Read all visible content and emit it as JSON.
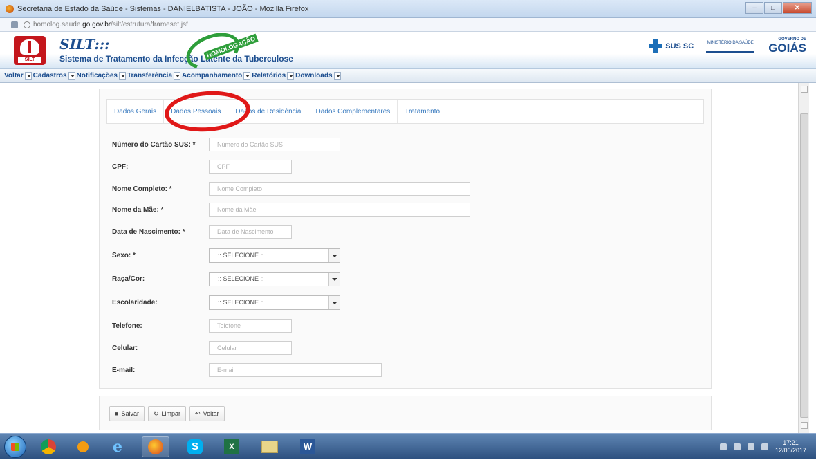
{
  "window": {
    "title": "Secretaria de Estado da Saúde - Sistemas - DANIELBATISTA - JOÃO - Mozilla Firefox",
    "controls": {
      "minimize": "–",
      "maximize": "□",
      "close": "✕"
    }
  },
  "urlbar": {
    "prefix": "homolog.saude.",
    "domain": "go.gov.br",
    "path": "/silt/estrutura/frameset.jsf"
  },
  "header": {
    "logo_tag": "SILT",
    "brand": "SILT:::",
    "subtitle": "Sistema de Tratamento da Infecção Latente da Tuberculose",
    "stamp_text": "HOMOLOGAÇÃO",
    "sus_label": "SUS SC",
    "ministry": "MINISTÉRIO DA SAÚDE",
    "goias_small": "GOVERNO DE",
    "goias": "GOIÁS"
  },
  "menu": [
    {
      "label": "Voltar"
    },
    {
      "label": "Cadastros"
    },
    {
      "label": "Notificações"
    },
    {
      "label": "Transferência"
    },
    {
      "label": "Acompanhamento"
    },
    {
      "label": "Relatórios"
    },
    {
      "label": "Downloads"
    }
  ],
  "tabs": [
    {
      "label": "Dados Gerais"
    },
    {
      "label": "Dados Pessoais"
    },
    {
      "label": "Dados de Residência"
    },
    {
      "label": "Dados Complementares"
    },
    {
      "label": "Tratamento"
    }
  ],
  "form": {
    "cartao_sus": {
      "label": "Número do Cartão SUS: *",
      "placeholder": "Número do Cartão SUS"
    },
    "cpf": {
      "label": "CPF:",
      "placeholder": "CPF"
    },
    "nome": {
      "label": "Nome Completo: *",
      "placeholder": "Nome Completo"
    },
    "mae": {
      "label": "Nome da Mãe: *",
      "placeholder": "Nome da Mãe"
    },
    "nascimento": {
      "label": "Data de Nascimento: *",
      "placeholder": "Data de Nascimento"
    },
    "sexo": {
      "label": "Sexo: *",
      "value": ":: SELECIONE ::"
    },
    "raca": {
      "label": "Raça/Cor:",
      "value": ":: SELECIONE ::"
    },
    "escolaridade": {
      "label": "Escolaridade:",
      "value": ":: SELECIONE ::"
    },
    "telefone": {
      "label": "Telefone:",
      "placeholder": "Telefone"
    },
    "celular": {
      "label": "Celular:",
      "placeholder": "Celular"
    },
    "email": {
      "label": "E-mail:",
      "placeholder": "E-mail"
    }
  },
  "buttons": {
    "salvar": "Salvar",
    "limpar": "Limpar",
    "voltar": "Voltar"
  },
  "taskbar": {
    "apps": [
      "ie",
      "chrome",
      "media-player",
      "internet-explorer",
      "firefox",
      "skype",
      "excel",
      "file-manager",
      "word"
    ],
    "time": "17:21",
    "date": "12/06/2017"
  },
  "colors": {
    "brand_blue": "#1d4e8f",
    "tab_blue": "#3a7bbf",
    "highlight_red": "#e01818",
    "stamp_green": "#2e9e3a"
  }
}
